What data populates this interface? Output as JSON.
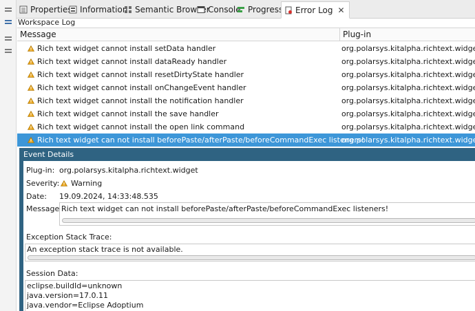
{
  "tabs": [
    {
      "label": "Properties",
      "icon": "properties-icon"
    },
    {
      "label": "Information",
      "icon": "information-icon"
    },
    {
      "label": "Semantic Browser",
      "icon": "semantic-browser-icon"
    },
    {
      "label": "Console",
      "icon": "console-icon"
    },
    {
      "label": "Progress",
      "icon": "progress-icon"
    },
    {
      "label": "Error Log",
      "icon": "error-log-icon",
      "active": true
    }
  ],
  "workspace_log": "Workspace Log",
  "table": {
    "columns": [
      "Message",
      "Plug-in"
    ],
    "rows": [
      {
        "message": "Rich text widget cannot install setData handler",
        "plugin": "org.polarsys.kitalpha.richtext.widget"
      },
      {
        "message": "Rich text widget cannot install dataReady handler",
        "plugin": "org.polarsys.kitalpha.richtext.widget"
      },
      {
        "message": "Rich text widget cannot install resetDirtyState handler",
        "plugin": "org.polarsys.kitalpha.richtext.widget"
      },
      {
        "message": "Rich text widget cannot install onChangeEvent handler",
        "plugin": "org.polarsys.kitalpha.richtext.widget"
      },
      {
        "message": "Rich text widget cannot install the notification handler",
        "plugin": "org.polarsys.kitalpha.richtext.widget"
      },
      {
        "message": "Rich text widget cannot install the save handler",
        "plugin": "org.polarsys.kitalpha.richtext.widget"
      },
      {
        "message": "Rich text widget cannot install the open link command",
        "plugin": "org.polarsys.kitalpha.richtext.widget"
      },
      {
        "message": "Rich text widget can not install beforePaste/afterPaste/beforeCommandExec listeners!",
        "plugin": "org.polarsys.kitalpha.richtext.widget",
        "selected": true
      }
    ]
  },
  "details": {
    "header": "Event Details",
    "plugin_label": "Plug-in:",
    "plugin_value": "org.polarsys.kitalpha.richtext.widget",
    "severity_label": "Severity:",
    "severity_value": "Warning",
    "date_label": "Date:",
    "date_value": "19.09.2024, 14:33:48.535",
    "message_label": "Message:",
    "message_value": "Rich text widget can not install beforePaste/afterPaste/beforeCommandExec listeners!",
    "stack_label": "Exception Stack Trace:",
    "stack_value": "An exception stack trace is not available.",
    "session_label": "Session Data:",
    "session_lines": [
      "eclipse.buildId=unknown",
      "java.version=17.0.11",
      "java.vendor=Eclipse Adoptium"
    ]
  },
  "colors": {
    "selection": "#3d96d8",
    "details_header": "#2f6382",
    "warning": "#e8a317"
  }
}
